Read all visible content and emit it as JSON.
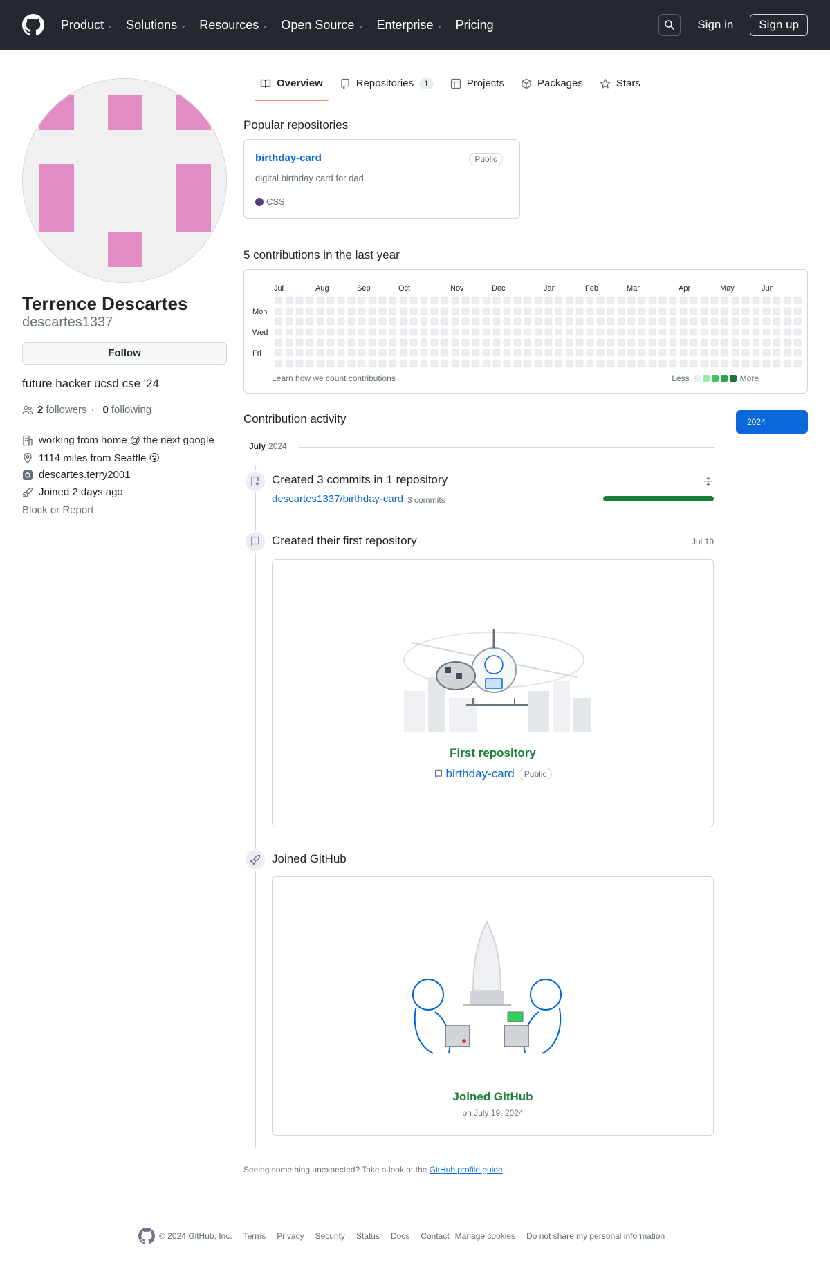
{
  "header": {
    "nav": [
      "Product",
      "Solutions",
      "Resources",
      "Open Source",
      "Enterprise",
      "Pricing"
    ],
    "sign_in": "Sign in",
    "sign_up": "Sign up"
  },
  "tabs": {
    "overview": "Overview",
    "repositories": "Repositories",
    "repositories_count": "1",
    "projects": "Projects",
    "packages": "Packages",
    "stars": "Stars"
  },
  "profile": {
    "name": "Terrence Descartes",
    "login": "descartes1337",
    "follow": "Follow",
    "bio": "future hacker ucsd cse '24",
    "followers_count": "2",
    "followers_label": "followers",
    "following_count": "0",
    "following_label": "following",
    "company": "working from home @ the next google",
    "location": "1114 miles from Seattle 😮",
    "social": "descartes.terry2001",
    "joined": "Joined 2 days ago",
    "block_report": "Block or Report"
  },
  "popular": {
    "title": "Popular repositories",
    "repo_name": "birthday-card",
    "visibility": "Public",
    "description": "digital birthday card for dad",
    "language": "CSS",
    "language_color": "#563d7c"
  },
  "contributions": {
    "title": "5 contributions in the last year",
    "months": [
      "Jul",
      "Aug",
      "Sep",
      "Oct",
      "Nov",
      "Dec",
      "Jan",
      "Feb",
      "Mar",
      "Apr",
      "May",
      "Jun"
    ],
    "days": [
      "Mon",
      "Wed",
      "Fri"
    ],
    "learn": "Learn how we count contributions",
    "less": "Less",
    "more": "More",
    "colors": [
      "#ebedf0",
      "#9be9a8",
      "#40c463",
      "#30a14e",
      "#216e39"
    ]
  },
  "activity": {
    "title": "Contribution activity",
    "year": "2024",
    "month": "July",
    "month_year": "2024",
    "commits_title": "Created 3 commits in 1 repository",
    "commits_repo": "descartes1337/birthday-card",
    "commits_count": "3 commits",
    "commits_progress": 1.0,
    "first_repo_title": "Created their first repository",
    "first_repo_date": "Jul 19",
    "first_repo_label": "First repository",
    "first_repo_name": "birthday-card",
    "first_repo_visibility": "Public",
    "joined_title": "Joined GitHub",
    "joined_label": "Joined GitHub",
    "joined_date": "on July 19, 2024"
  },
  "unexpected": {
    "text": "Seeing something unexpected? Take a look at the",
    "link": "GitHub profile guide",
    "end": "."
  },
  "footer": {
    "copyright": "© 2024 GitHub, Inc.",
    "links": [
      "Terms",
      "Privacy",
      "Security",
      "Status",
      "Docs",
      "Contact",
      "Manage cookies",
      "Do not share my personal information"
    ]
  }
}
